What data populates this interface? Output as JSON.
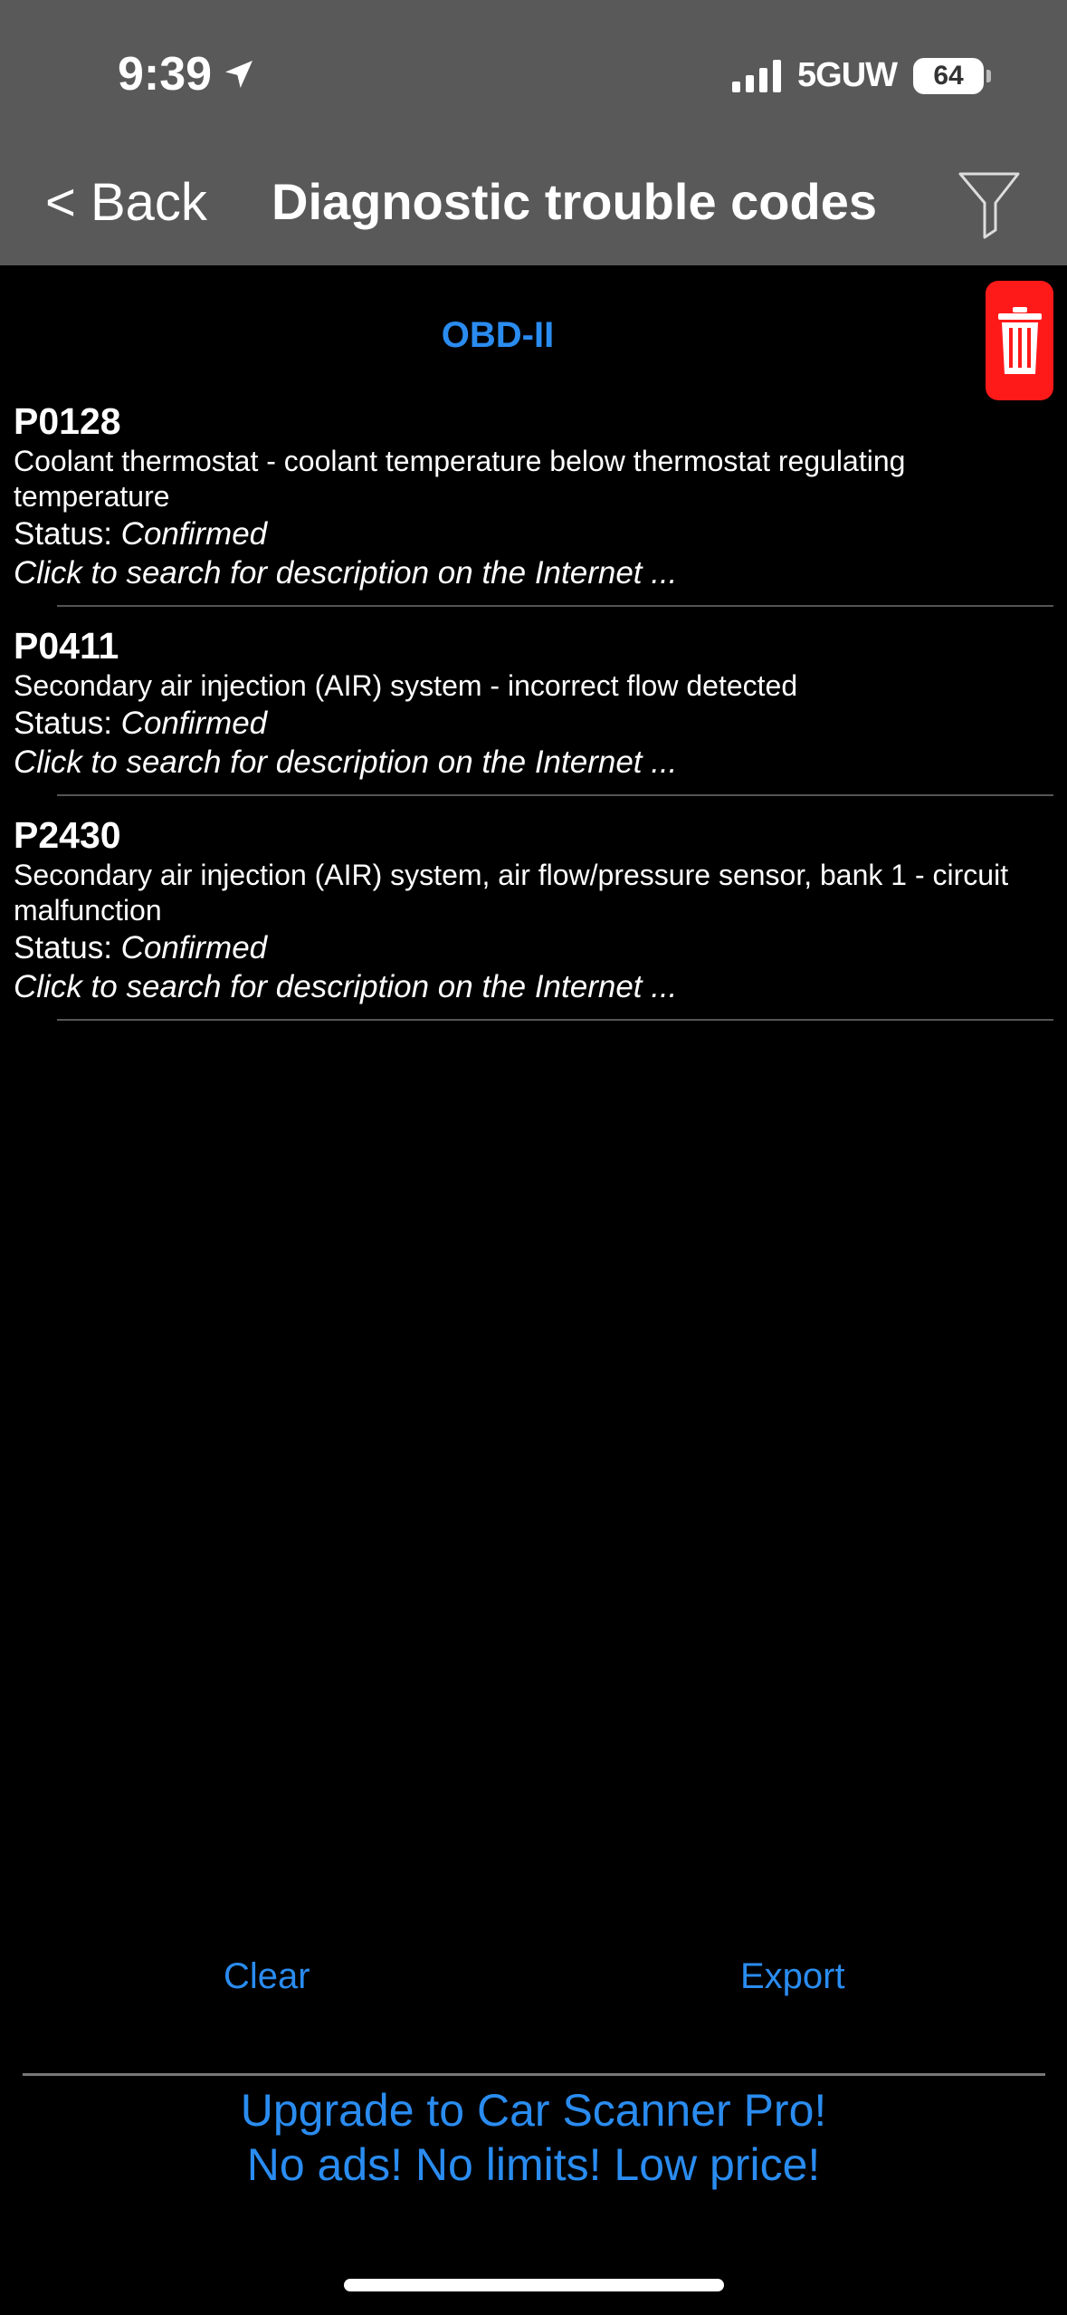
{
  "status_bar": {
    "time": "9:39",
    "network": "5GUW",
    "battery": "64"
  },
  "nav": {
    "back_label": "< Back",
    "title": "Diagnostic trouble codes",
    "filter_icon": "filter-icon"
  },
  "section": {
    "title": "OBD-II",
    "delete_icon": "trash-icon"
  },
  "dtc_list": [
    {
      "code": "P0128",
      "description": "Coolant thermostat - coolant temperature below thermostat regulating temperature",
      "status_label": "Status: ",
      "status_value": "Confirmed",
      "search_text": "Click to search for description on the Internet ..."
    },
    {
      "code": "P0411",
      "description": "Secondary air injection (AIR) system - incorrect flow detected",
      "status_label": "Status: ",
      "status_value": "Confirmed",
      "search_text": "Click to search for description on the Internet ..."
    },
    {
      "code": "P2430",
      "description": "Secondary air injection (AIR) system, air flow/pressure sensor, bank 1 - circuit malfunction",
      "status_label": "Status: ",
      "status_value": "Confirmed",
      "search_text": "Click to search for description on the Internet ..."
    }
  ],
  "actions": {
    "clear_label": "Clear",
    "export_label": "Export"
  },
  "ad": {
    "line1": "Upgrade to Car Scanner Pro!",
    "line2": "No ads! No limits! Low price!"
  },
  "colors": {
    "header_bg": "#595959",
    "accent": "#2a8cf0",
    "delete_bg": "#ff1a1a"
  }
}
